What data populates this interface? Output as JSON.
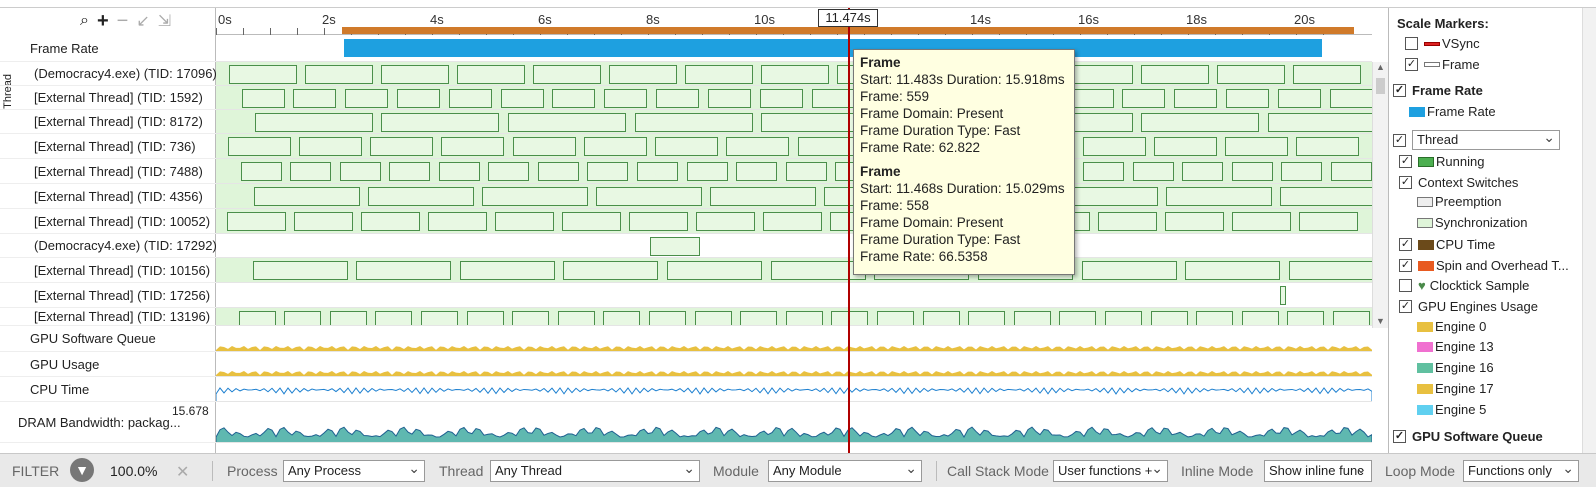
{
  "toolbar": {
    "search_icon": "search-icon",
    "zoom_in_icon": "plus-icon",
    "zoom_out_icon": "minus-icon",
    "undo_zoom_icon": "undo-zoom-icon",
    "reset_zoom_icon": "reset-zoom-icon"
  },
  "timeline": {
    "ticks": [
      "0s",
      "2s",
      "4s",
      "6s",
      "8s",
      "10s",
      "14s",
      "16s",
      "18s",
      "20s"
    ],
    "cursor_label": "11.474s"
  },
  "thread_group_label": "Thread",
  "rows": [
    {
      "label": "Frame Rate"
    },
    {
      "label": "(Democracy4.exe) (TID: 17096)"
    },
    {
      "label": "[External Thread] (TID: 1592)"
    },
    {
      "label": "[External Thread] (TID: 8172)"
    },
    {
      "label": "[External Thread] (TID: 736)"
    },
    {
      "label": "[External Thread] (TID: 7488)"
    },
    {
      "label": "[External Thread] (TID: 4356)"
    },
    {
      "label": "[External Thread] (TID: 10052)"
    },
    {
      "label": "(Democracy4.exe) (TID: 17292)"
    },
    {
      "label": "[External Thread] (TID: 10156)"
    },
    {
      "label": "[External Thread] (TID: 17256)"
    },
    {
      "label": "[External Thread] (TID: 13196)"
    },
    {
      "label": "GPU Software Queue"
    },
    {
      "label": "GPU Usage"
    },
    {
      "label": "CPU Time"
    },
    {
      "label": "DRAM Bandwidth: packag..."
    }
  ],
  "dram_max": "15.678",
  "tooltip": [
    {
      "title": "Frame",
      "start": "Start: 11.483s Duration: 15.918ms",
      "frame": "Frame: 559",
      "domain": "Frame Domain: Present",
      "type": "Frame Duration Type: Fast",
      "rate": "Frame Rate: 62.822"
    },
    {
      "title": "Frame",
      "start": "Start: 11.468s Duration: 15.029ms",
      "frame": "Frame: 558",
      "domain": "Frame Domain: Present",
      "type": "Frame Duration Type: Fast",
      "rate": "Frame Rate: 66.5358"
    }
  ],
  "legend": {
    "scale_markers": "Scale Markers:",
    "vsync": "VSync",
    "frame": "Frame",
    "frame_rate_group": "Frame Rate",
    "frame_rate": "Frame Rate",
    "thread_select": "Thread",
    "running": "Running",
    "context_switches": "Context Switches",
    "preemption": "Preemption",
    "synchronization": "Synchronization",
    "cpu_time": "CPU Time",
    "spin": "Spin and Overhead T...",
    "clocktick": "Clocktick Sample",
    "gpu_engines": "GPU Engines Usage",
    "engines": [
      "Engine 0",
      "Engine 13",
      "Engine 16",
      "Engine 17",
      "Engine 5"
    ],
    "gpu_sw_queue": "GPU Software Queue"
  },
  "status": {
    "filter": "FILTER",
    "percent": "100.0%",
    "process_label": "Process",
    "process_value": "Any Process",
    "thread_label": "Thread",
    "thread_value": "Any Thread",
    "module_label": "Module",
    "module_value": "Any Module",
    "callstack_label": "Call Stack Mode",
    "callstack_value": "User functions +",
    "inline_label": "Inline Mode",
    "inline_value": "Show inline func",
    "loop_label": "Loop Mode",
    "loop_value": "Functions only"
  },
  "colors": {
    "running": "#4caf50",
    "frame_rate": "#1ea0e0",
    "cursor": "#b00000",
    "tooltip_bg": "#ffffe1",
    "timeline_bar": "#d07a2a"
  }
}
